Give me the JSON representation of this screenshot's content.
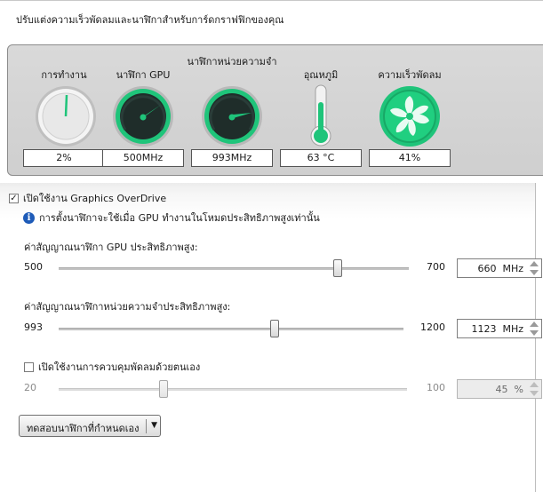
{
  "header": {
    "title": "ปรับแต่งความเร็วพัดลมและนาฬิกาสำหรับการ์ดกราฟฟิกของคุณ"
  },
  "gauges": [
    {
      "label": "การทำงาน",
      "value": "2%",
      "level": 0.02,
      "icon": "activity-dial-icon"
    },
    {
      "label": "นาฬิกา GPU",
      "value": "500MHz",
      "icon": "gpu-clock-dial-icon"
    },
    {
      "label": "นาฬิกาหน่วยความจำ",
      "value": "993MHz",
      "icon": "memory-clock-dial-icon"
    },
    {
      "label": "อุณหภูมิ",
      "value": "63 °C",
      "icon": "thermometer-icon"
    },
    {
      "label": "ความเร็วพัดลม",
      "value": "41%",
      "icon": "fan-icon"
    }
  ],
  "overdrive": {
    "enable_label": "เปิดใช้งาน Graphics OverDrive",
    "enabled": true,
    "info_text": "การตั้งนาฬิกาจะใช้เมื่อ GPU ทำงานในโหมดประสิทธิภาพสูงเท่านั้น",
    "info_icon": "i"
  },
  "gpu_clock": {
    "label": "ค่าสัญญาณนาฬิกา GPU ประสิทธิภาพสูง:",
    "min": "500",
    "max": "700",
    "value": "660",
    "unit": "MHz"
  },
  "memory_clock": {
    "label": "ค่าสัญญาณนาฬิกาหน่วยความจำประสิทธิภาพสูง:",
    "min": "993",
    "max": "1200",
    "value": "1123",
    "unit": "MHz"
  },
  "fan": {
    "enable_label": "เปิดใช้งานการควบคุมพัดลมด้วยตนเอง",
    "enabled": false,
    "min": "20",
    "max": "100",
    "value": "45",
    "unit": "%"
  },
  "test_button": {
    "label": "ทดสอบนาฬิกาที่กำหนดเอง"
  },
  "colors": {
    "dial_green": "#1fc47a",
    "dial_dark": "#1f2d2a",
    "panel_bg": "#d5d5d5",
    "info_blue": "#1e5bb8"
  }
}
